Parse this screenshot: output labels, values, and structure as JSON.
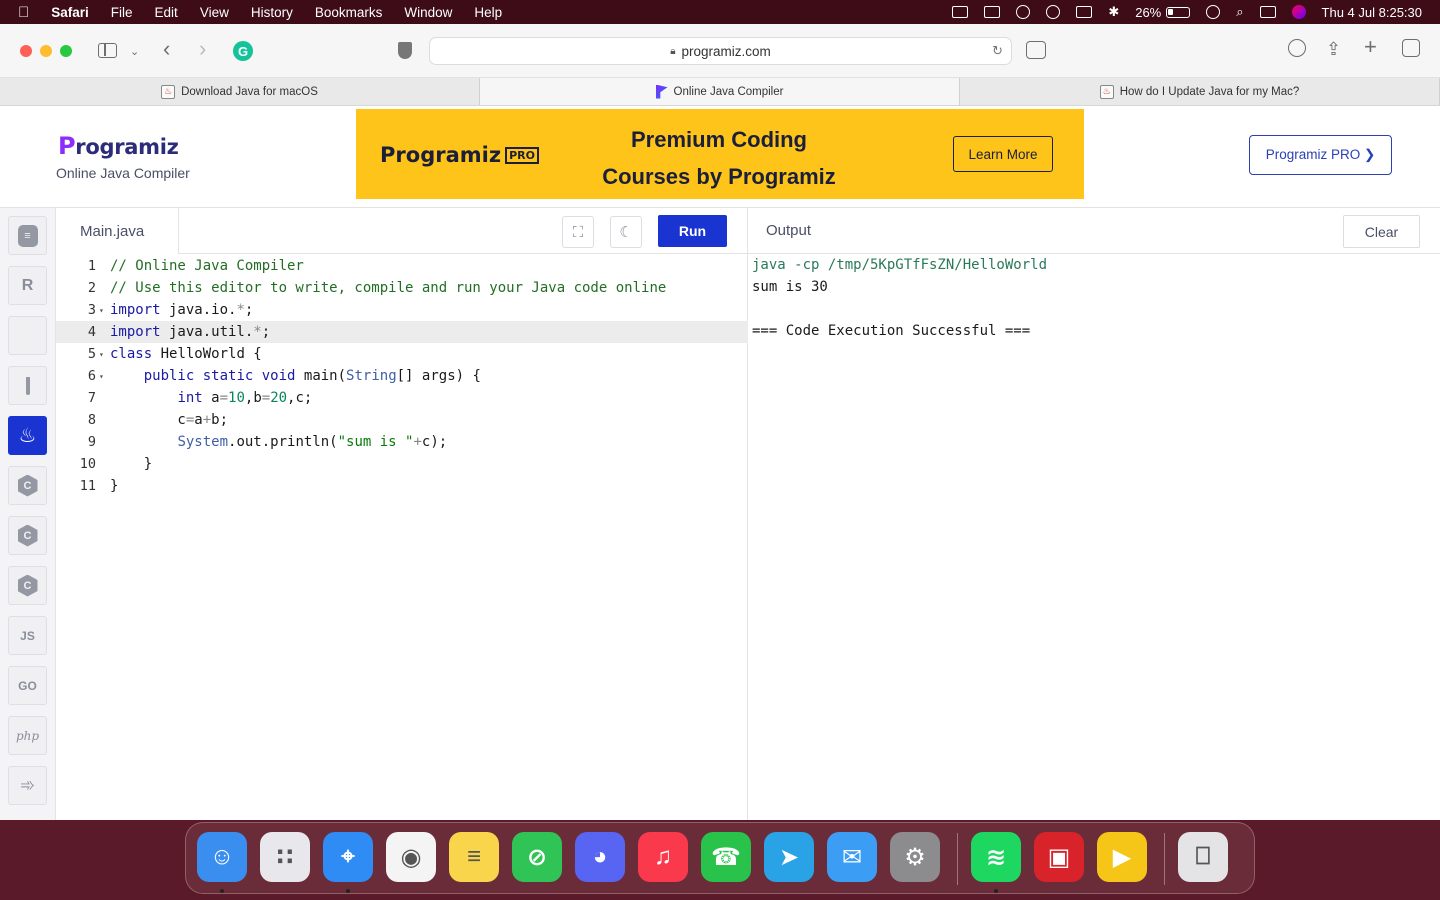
{
  "menubar": {
    "app": "Safari",
    "items": [
      "File",
      "Edit",
      "View",
      "History",
      "Bookmarks",
      "Window",
      "Help"
    ],
    "battery": "26%",
    "datetime": "Thu 4 Jul  8:25:30"
  },
  "browser": {
    "url": "programiz.com",
    "tabs": [
      {
        "label": "Download Java for macOS",
        "active": false
      },
      {
        "label": "Online Java Compiler",
        "active": true
      },
      {
        "label": "How do I Update Java for my Mac?",
        "active": false
      }
    ]
  },
  "header": {
    "logo_p": "P",
    "logo_rest": "rogramiz",
    "subtitle": "Online Java Compiler",
    "banner": {
      "logo_p": "P",
      "logo_rest": "rogramiz",
      "logo_badge": "PRO",
      "title_line1": "Premium Coding",
      "title_line2": "Courses by Programiz",
      "button": "Learn More",
      "color": "#ffc41a"
    },
    "pro_button": "Programiz PRO ❯"
  },
  "languages": [
    {
      "name": "python",
      "icon": "python-icon",
      "active": false
    },
    {
      "name": "r",
      "icon": "r-icon",
      "active": false
    },
    {
      "name": "sql",
      "icon": "database-icon",
      "active": false
    },
    {
      "name": "html",
      "icon": "html5-icon",
      "active": false
    },
    {
      "name": "java",
      "icon": "java-icon",
      "active": true
    },
    {
      "name": "c",
      "icon": "c-icon",
      "active": false
    },
    {
      "name": "csharp",
      "icon": "csharp-icon",
      "active": false
    },
    {
      "name": "cpp",
      "icon": "cpp-icon",
      "active": false
    },
    {
      "name": "js",
      "label": "JS",
      "icon": "js-icon",
      "active": false
    },
    {
      "name": "go",
      "label": "GO",
      "icon": "go-icon",
      "active": false
    },
    {
      "name": "php",
      "label": "php",
      "icon": "php-icon",
      "active": false
    },
    {
      "name": "swift",
      "icon": "swift-icon",
      "active": false
    }
  ],
  "editor": {
    "filename": "Main.java",
    "run_label": "Run",
    "accent": "#1a34d2",
    "lines": [
      {
        "n": "1",
        "fold": false,
        "text": "// Online Java Compiler"
      },
      {
        "n": "2",
        "fold": false,
        "text": "// Use this editor to write, compile and run your Java code online"
      },
      {
        "n": "3",
        "fold": true,
        "text": "import java.io.*;"
      },
      {
        "n": "4",
        "fold": false,
        "text": "import java.util.*;",
        "highlight": true
      },
      {
        "n": "5",
        "fold": true,
        "text": "class HelloWorld {"
      },
      {
        "n": "6",
        "fold": true,
        "text": "    public static void main(String[] args) {"
      },
      {
        "n": "7",
        "fold": false,
        "text": "        int a=10,b=20,c;"
      },
      {
        "n": "8",
        "fold": false,
        "text": "        c=a+b;"
      },
      {
        "n": "9",
        "fold": false,
        "text": "        System.out.println(\"sum is \"+c);"
      },
      {
        "n": "10",
        "fold": false,
        "text": "    }"
      },
      {
        "n": "11",
        "fold": false,
        "text": "}"
      }
    ]
  },
  "output": {
    "title": "Output",
    "clear_label": "Clear",
    "lines": [
      "java -cp /tmp/5KpGTfFsZN/HelloWorld",
      "sum is 30",
      "",
      "=== Code Execution Successful ==="
    ]
  },
  "dock": [
    {
      "name": "finder",
      "color": "#3a8ef0",
      "running": true
    },
    {
      "name": "launchpad",
      "color": "#e8e8ec",
      "running": false
    },
    {
      "name": "safari",
      "color": "#2f8cf5",
      "running": true
    },
    {
      "name": "chrome",
      "color": "#f4f4f4",
      "running": false
    },
    {
      "name": "notes",
      "color": "#f8d54a",
      "running": false
    },
    {
      "name": "blocker",
      "color": "#2fc455",
      "running": false
    },
    {
      "name": "discord",
      "color": "#5865f2",
      "running": false
    },
    {
      "name": "music",
      "color": "#fa3a4c",
      "running": false
    },
    {
      "name": "whatsapp",
      "color": "#29c24a",
      "running": false
    },
    {
      "name": "telegram",
      "color": "#2aa3e6",
      "running": false
    },
    {
      "name": "mail",
      "color": "#3c9df5",
      "running": false
    },
    {
      "name": "system-settings",
      "color": "#8c8c8f",
      "running": false
    },
    {
      "name": "spotify",
      "color": "#1ed760",
      "running": true
    },
    {
      "name": "photo-booth",
      "color": "#d8232a",
      "running": false
    },
    {
      "name": "media-player",
      "color": "#f5c518",
      "running": false
    },
    {
      "name": "trash",
      "color": "#e4e4e6",
      "running": false
    }
  ]
}
